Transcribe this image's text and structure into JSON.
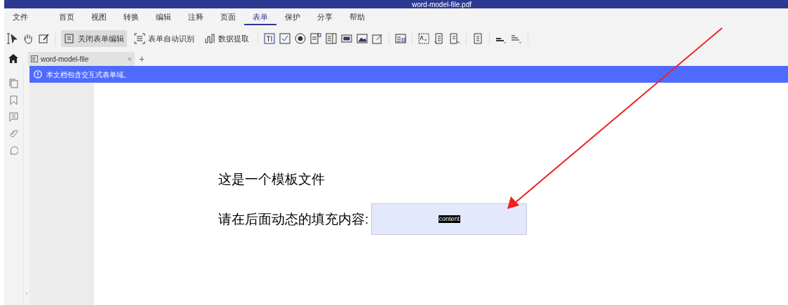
{
  "window": {
    "title": "word-model-file.pdf"
  },
  "menu": [
    {
      "label": "文件",
      "selected": false
    },
    {
      "label": "首页",
      "selected": false
    },
    {
      "label": "视图",
      "selected": false
    },
    {
      "label": "转换",
      "selected": false
    },
    {
      "label": "编辑",
      "selected": false
    },
    {
      "label": "注释",
      "selected": false
    },
    {
      "label": "页面",
      "selected": false
    },
    {
      "label": "表单",
      "selected": true
    },
    {
      "label": "保护",
      "selected": false
    },
    {
      "label": "分享",
      "selected": false
    },
    {
      "label": "帮助",
      "selected": false
    }
  ],
  "toolbar": [
    {
      "label": "关闭表单编辑",
      "selected": true
    },
    {
      "label": "表单自动识别",
      "selected": false
    },
    {
      "label": "数据提取",
      "selected": false
    }
  ],
  "tabs": [
    {
      "label": "word-model-file",
      "selected": true,
      "close": "×"
    }
  ],
  "new_tab": "+",
  "panel_toggle": "›",
  "banner": {
    "text": "本文档包含交互式表单域。"
  },
  "document": {
    "lines": [
      "这是一个模板文件"
    ],
    "field_label": "请在后面动态的填充内容:",
    "field": {
      "value": "content",
      "highlighted": true
    }
  }
}
